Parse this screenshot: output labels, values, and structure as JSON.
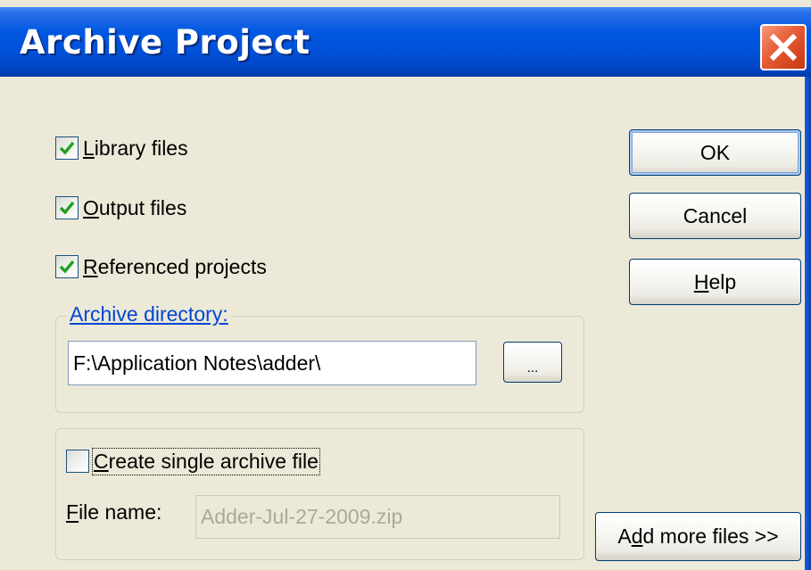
{
  "dialog": {
    "title": "Archive Project"
  },
  "checkboxes": {
    "library_files": {
      "label_mnemonic": "L",
      "label_rest": "ibrary files",
      "checked": true
    },
    "output_files": {
      "label_mnemonic": "O",
      "label_rest": "utput files",
      "checked": true
    },
    "referenced_projects": {
      "label_mnemonic": "R",
      "label_rest": "eferenced projects",
      "checked": true
    }
  },
  "archive_directory": {
    "legend": "Archive directory:",
    "path": "F:\\Application Notes\\adder\\",
    "browse_label": "..."
  },
  "single_archive": {
    "checkbox_mnemonic": "C",
    "checkbox_rest": "reate single archive file",
    "checked": false,
    "file_name_label_mnemonic": "F",
    "file_name_label_rest": "ile name:",
    "file_name_value": "Adder-Jul-27-2009.zip"
  },
  "buttons": {
    "ok": "OK",
    "cancel": "Cancel",
    "help_mnemonic": "H",
    "help_rest": "elp",
    "add_more_pre": "A",
    "add_more_mnemonic": "d",
    "add_more_rest": "d more files >>"
  },
  "colors": {
    "titlebar": "#0058e0",
    "dialog_bg": "#ece9d8",
    "close_button": "#e8623c",
    "check_mark": "#21a121",
    "group_legend": "#0046d5",
    "disabled_text": "#aca899"
  },
  "icons": {
    "close": "close-x-icon",
    "check": "checkmark-icon"
  }
}
